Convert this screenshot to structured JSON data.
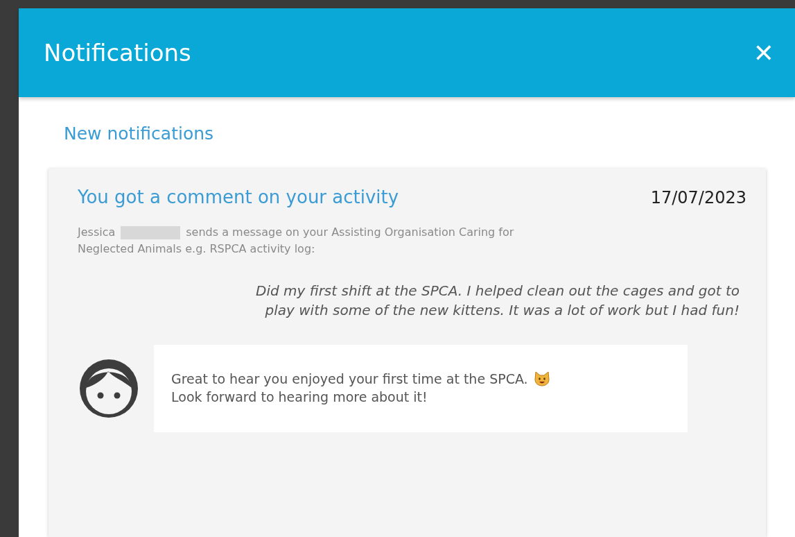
{
  "dialog": {
    "title": "Notifications",
    "close": "✕"
  },
  "section": {
    "heading": "New notifications"
  },
  "notifications": [
    {
      "title": "You got a comment on your activity",
      "date": "17/07/2023",
      "author": "Jessica",
      "name_redacted": true,
      "message": [
        "sends a message on your Assisting Organisation Caring for",
        "Neglected Animals e.g. RSPCA activity log:"
      ],
      "quote": "Did my first shift at the SPCA. I helped clean out the cages and got to play with some of the new kittens. It was a lot of work but I had fun!",
      "reply": {
        "line_1": "Great to hear you enjoyed your first time at the SPCA.",
        "line_2": "Look forward to hearing more about it!"
      }
    }
  ]
}
